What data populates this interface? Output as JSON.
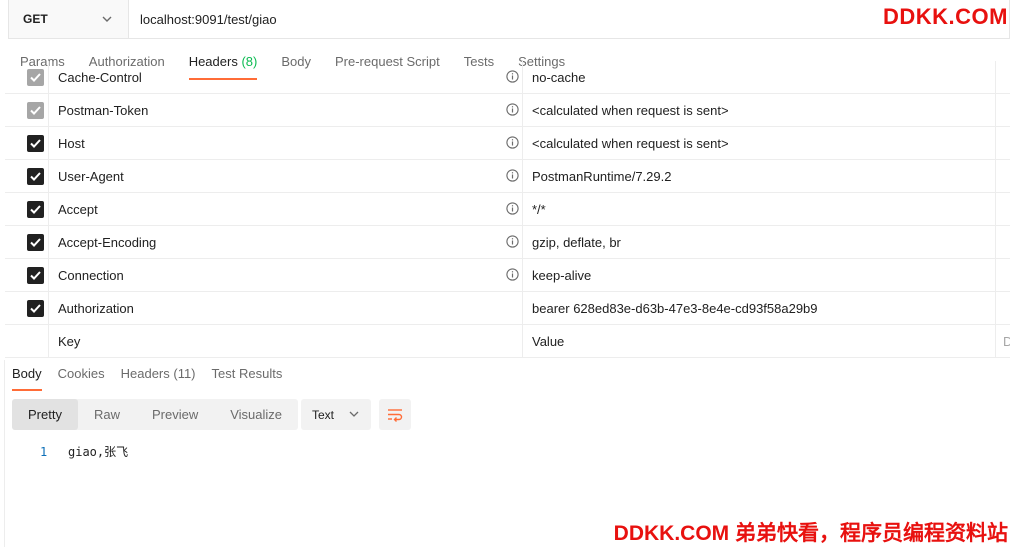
{
  "request": {
    "method": "GET",
    "url": "localhost:9091/test/giao"
  },
  "brand": {
    "top": "DDKK.COM",
    "bottom": "DDKK.COM 弟弟快看，程序员编程资料站"
  },
  "request_tabs": [
    {
      "label": "Params"
    },
    {
      "label": "Authorization"
    },
    {
      "label": "Headers",
      "count": "(8)"
    },
    {
      "label": "Body"
    },
    {
      "label": "Pre-request Script"
    },
    {
      "label": "Tests"
    },
    {
      "label": "Settings"
    }
  ],
  "headers": [
    {
      "key": "Cache-Control",
      "value": "no-cache",
      "checked": true,
      "disabled": true
    },
    {
      "key": "Postman-Token",
      "value": "<calculated when request is sent>",
      "checked": true,
      "disabled": true
    },
    {
      "key": "Host",
      "value": "<calculated when request is sent>",
      "checked": true,
      "disabled": false
    },
    {
      "key": "User-Agent",
      "value": "PostmanRuntime/7.29.2",
      "checked": true,
      "disabled": false
    },
    {
      "key": "Accept",
      "value": "*/*",
      "checked": true,
      "disabled": false
    },
    {
      "key": "Accept-Encoding",
      "value": "gzip, deflate, br",
      "checked": true,
      "disabled": false
    },
    {
      "key": "Connection",
      "value": "keep-alive",
      "checked": true,
      "disabled": false
    },
    {
      "key": "Authorization",
      "value": "bearer 628ed83e-d63b-47e3-8e4e-cd93f58a29b9",
      "checked": true,
      "disabled": false
    }
  ],
  "new_row": {
    "key_placeholder": "Key",
    "value_placeholder": "Value",
    "desc_partial": "D"
  },
  "response_tabs": [
    {
      "label": "Body"
    },
    {
      "label": "Cookies"
    },
    {
      "label": "Headers (11)"
    },
    {
      "label": "Test Results"
    }
  ],
  "view_modes": [
    "Pretty",
    "Raw",
    "Preview",
    "Visualize"
  ],
  "format": "Text",
  "response_body": {
    "line_number": "1",
    "text": "giao,张飞"
  },
  "colors": {
    "accent": "#ff6c37",
    "brand": "#e8110f",
    "count": "#0cbb52"
  }
}
